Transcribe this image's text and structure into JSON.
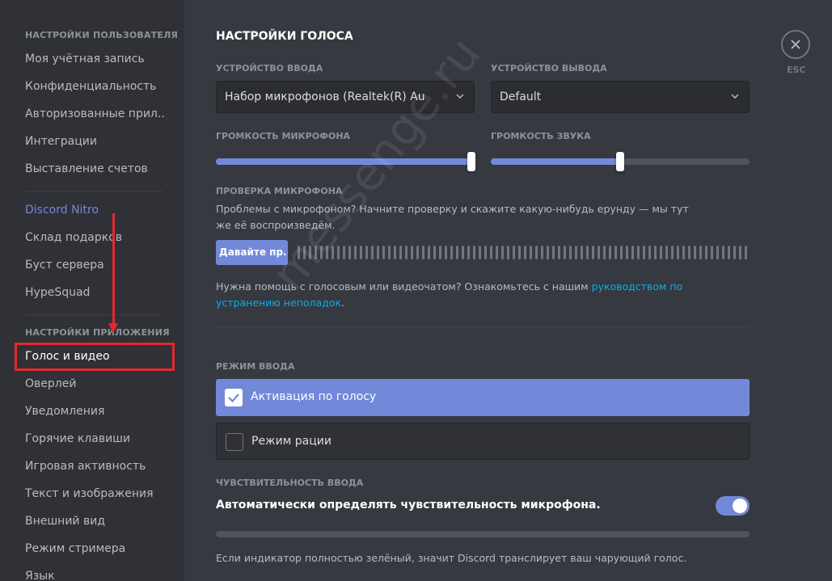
{
  "sidebar": {
    "user_header": "НАСТРОЙКИ ПОЛЬЗОВАТЕЛЯ",
    "user_items": [
      "Моя учётная запись",
      "Конфиденциальность",
      "Авторизованные прил...",
      "Интеграции",
      "Выставление счетов"
    ],
    "nitro_items": [
      "Discord Nitro",
      "Склад подарков",
      "Буст сервера",
      "HypeSquad"
    ],
    "app_header": "НАСТРОЙКИ ПРИЛОЖЕНИЯ",
    "app_items": [
      "Голос и видео",
      "Оверлей",
      "Уведомления",
      "Горячие клавиши",
      "Игровая активность",
      "Текст и изображения",
      "Внешний вид",
      "Режим стримера",
      "Язык"
    ],
    "selected_item": "Голос и видео"
  },
  "main": {
    "title": "НАСТРОЙКИ ГОЛОСА",
    "input_device_label": "УСТРОЙСТВО ВВОДА",
    "input_device_value": "Набор микрофонов (Realtek(R) Au",
    "output_device_label": "УСТРОЙСТВО ВЫВОДА",
    "output_device_value": "Default",
    "mic_volume_label": "ГРОМКОСТЬ МИКРОФОНА",
    "mic_volume": 1.0,
    "sound_volume_label": "ГРОМКОСТЬ ЗВУКА",
    "sound_volume": 0.5,
    "mic_test_label": "ПРОВЕРКА МИКРОФОНА",
    "mic_test_desc": "Проблемы с микрофоном? Начните проверку и скажите какую-нибудь ерунду — мы тут же её воспроизведём.",
    "mic_test_button": "Давайте пр...",
    "help_text": "Нужна помощь с голосовым или видеочатом? Ознакомьтесь с нашим ",
    "help_link": "руководством по устранению неполадок",
    "help_suffix": ".",
    "input_mode_label": "РЕЖИМ ВВОДА",
    "mode_voice": "Активация по голосу",
    "mode_ptt": "Режим рации",
    "sensitivity_label": "ЧУВСТВИТЕЛЬНОСТЬ ВВОДА",
    "auto_sensitivity": "Автоматически определять чувствительность микрофона.",
    "auto_sensitivity_on": true,
    "sensitivity_note": "Если индикатор полностью зелёный, значит Discord транслирует ваш чарующий голос.",
    "close_label": "ESC"
  },
  "watermark": "messenge.ru",
  "colors": {
    "accent": "#7289da",
    "link": "#00b0f4",
    "highlight": "#e22a2a"
  }
}
